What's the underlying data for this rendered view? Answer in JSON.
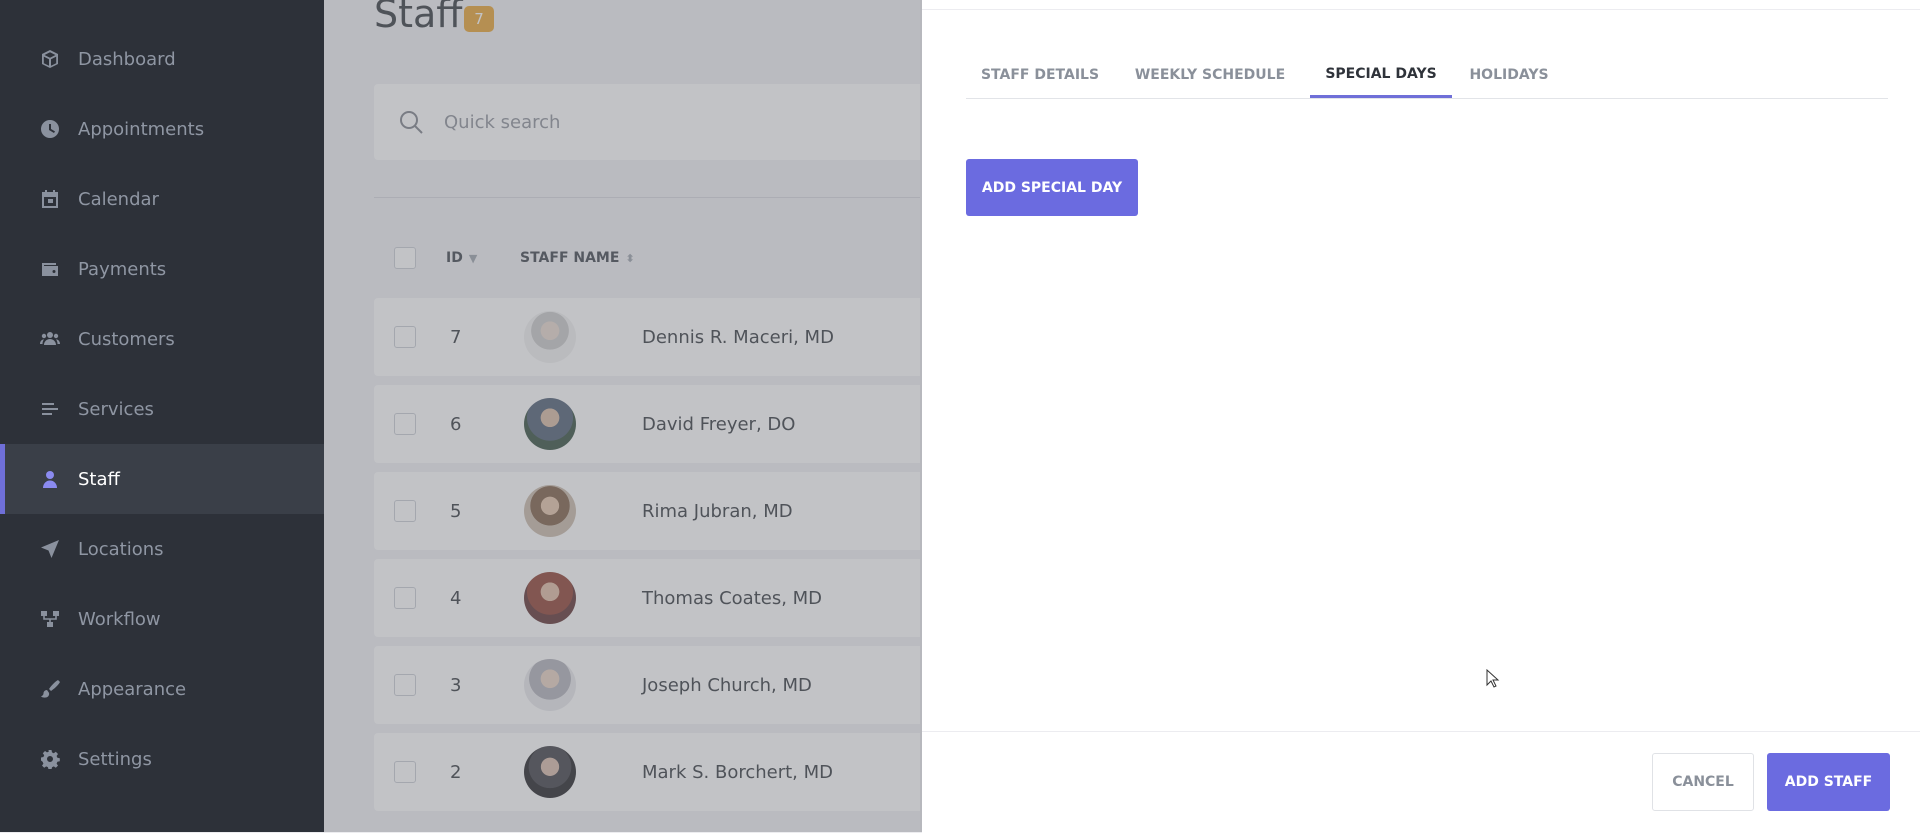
{
  "sidebar": {
    "items": [
      {
        "label": "Dashboard",
        "icon": "cube-icon"
      },
      {
        "label": "Appointments",
        "icon": "clock-icon"
      },
      {
        "label": "Calendar",
        "icon": "calendar-icon"
      },
      {
        "label": "Payments",
        "icon": "wallet-icon"
      },
      {
        "label": "Customers",
        "icon": "users-icon"
      },
      {
        "label": "Services",
        "icon": "list-icon"
      },
      {
        "label": "Staff",
        "icon": "user-icon",
        "active": true
      },
      {
        "label": "Locations",
        "icon": "location-arrow-icon"
      },
      {
        "label": "Workflow",
        "icon": "workflow-icon"
      },
      {
        "label": "Appearance",
        "icon": "brush-icon"
      },
      {
        "label": "Settings",
        "icon": "gear-icon"
      }
    ]
  },
  "main": {
    "title": "Staff",
    "count": "7",
    "search": {
      "placeholder": "Quick search"
    },
    "table": {
      "headers": {
        "id": "ID",
        "name": "STAFF NAME"
      },
      "rows": [
        {
          "id": "7",
          "name": "Dennis R. Maceri, MD"
        },
        {
          "id": "6",
          "name": "David Freyer, DO"
        },
        {
          "id": "5",
          "name": "Rima Jubran, MD"
        },
        {
          "id": "4",
          "name": "Thomas Coates, MD"
        },
        {
          "id": "3",
          "name": "Joseph Church, MD"
        },
        {
          "id": "2",
          "name": "Mark S. Borchert, MD"
        }
      ]
    }
  },
  "panel": {
    "tabs": [
      {
        "label": "STAFF DETAILS"
      },
      {
        "label": "WEEKLY SCHEDULE"
      },
      {
        "label": "SPECIAL DAYS",
        "active": true
      },
      {
        "label": "HOLIDAYS"
      }
    ],
    "add_special_day_label": "ADD SPECIAL DAY",
    "cancel_label": "CANCEL",
    "add_staff_label": "ADD STAFF"
  },
  "colors": {
    "sidebar_bg": "#2d3139",
    "accent": "#6b6be0",
    "badge": "#e8a12c"
  }
}
